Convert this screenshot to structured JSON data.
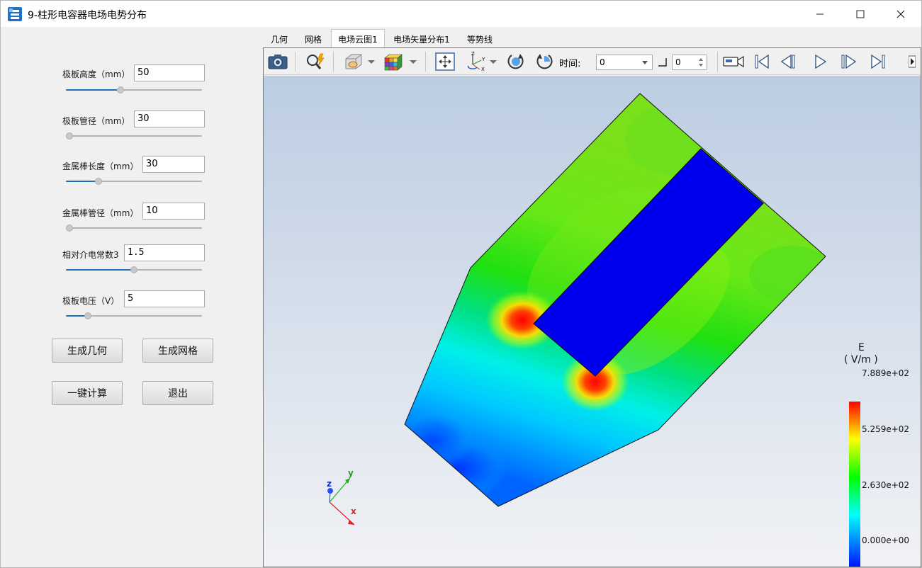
{
  "window": {
    "title": "9-柱形电容器电场电势分布",
    "controls": [
      "minimize-icon",
      "maximize-icon",
      "close-icon"
    ]
  },
  "params": [
    {
      "label": "极板高度（mm）",
      "value": "50",
      "slider_fraction": 0.4
    },
    {
      "label": "极板管径（mm）",
      "value": "30",
      "slider_fraction": 0.0
    },
    {
      "label": "金属棒长度（mm）",
      "value": "30",
      "slider_fraction": 0.24
    },
    {
      "label": "金属棒管径（mm）",
      "value": "10",
      "slider_fraction": 0.0
    },
    {
      "label": "相对介电常数3",
      "value": "1.5",
      "slider_fraction": 0.5
    },
    {
      "label": "极板电压（V）",
      "value": "5",
      "slider_fraction": 0.16
    }
  ],
  "buttons": {
    "gen_geometry": "生成几何",
    "gen_mesh": "生成网格",
    "compute": "一键计算",
    "exit": "退出"
  },
  "tabs": [
    {
      "label": "几何",
      "active": false
    },
    {
      "label": "网格",
      "active": false
    },
    {
      "label": "电场云图1",
      "active": true
    },
    {
      "label": "电场矢量分布1",
      "active": false
    },
    {
      "label": "等势线",
      "active": false
    }
  ],
  "toolbar": {
    "time_label": "时间:",
    "time_value": "0",
    "spin_value": "0",
    "icons": [
      "camera-icon",
      "zoom-icon",
      "display-mode-icon",
      "colormap-icon",
      "fit-view-icon",
      "axes-icon",
      "rotate-cw-icon",
      "rotate-ccw-icon",
      "record-video-icon",
      "first-frame-icon",
      "prev-frame-icon",
      "play-icon",
      "next-frame-icon",
      "last-frame-icon",
      "more-icon"
    ]
  },
  "colorbar": {
    "title": "E",
    "unit": "( V/m )",
    "max": "7.889e+02",
    "mid_high": "5.259e+02",
    "mid_low": "2.630e+02",
    "min": "0.000e+00"
  },
  "axes": {
    "x": "x",
    "y": "y",
    "z": "z"
  },
  "colors": {
    "accent": "#1f6fb8",
    "field_low": "#0000ff",
    "field_high": "#ff0000"
  }
}
